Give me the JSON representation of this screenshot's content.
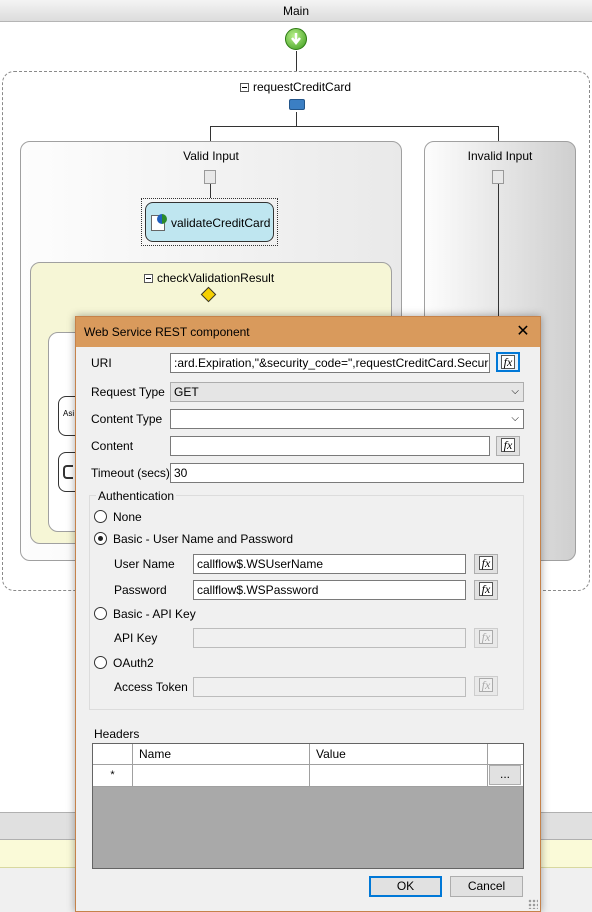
{
  "window": {
    "title": "Main"
  },
  "workflow": {
    "request_scope_title": "requestCreditCard",
    "valid_branch_title": "Valid Input",
    "invalid_branch_title": "Invalid Input",
    "activity_label": "validateCreditCard",
    "check_scope_title": "checkValidationResult",
    "hidden_left_label": "Asi"
  },
  "dialog": {
    "title": "Web Service REST component",
    "close_glyph": "✕",
    "uri_label": "URI",
    "uri_value": ":ard.Expiration,\"&security_code=\",requestCreditCard.SecurityCode)",
    "request_type_label": "Request Type",
    "request_type_value": "GET",
    "content_type_label": "Content Type",
    "content_type_value": "",
    "content_label": "Content",
    "content_value": "",
    "timeout_label": "Timeout (secs)",
    "timeout_value": "30",
    "fx_label": "fx",
    "auth": {
      "legend": "Authentication",
      "options": [
        "None",
        "Basic - User Name and Password",
        "Basic - API Key",
        "OAuth2"
      ],
      "selected": "Basic - User Name and Password",
      "username_label": "User Name",
      "username_value": "callflow$.WSUserName",
      "password_label": "Password",
      "password_value": "callflow$.WSPassword",
      "apikey_label": "API Key",
      "apikey_value": "",
      "token_label": "Access Token",
      "token_value": ""
    },
    "headers": {
      "label": "Headers",
      "columns": [
        "Name",
        "Value"
      ],
      "new_row_marker": "*",
      "ellipsis_button": "..."
    },
    "ok_label": "OK",
    "cancel_label": "Cancel"
  },
  "colors": {
    "dialog_title_bg": "#d99a5c",
    "activity_fill": "#bfe6f0",
    "check_scope_fill": "#f6f6d6",
    "focus_blue": "#0078d7"
  }
}
